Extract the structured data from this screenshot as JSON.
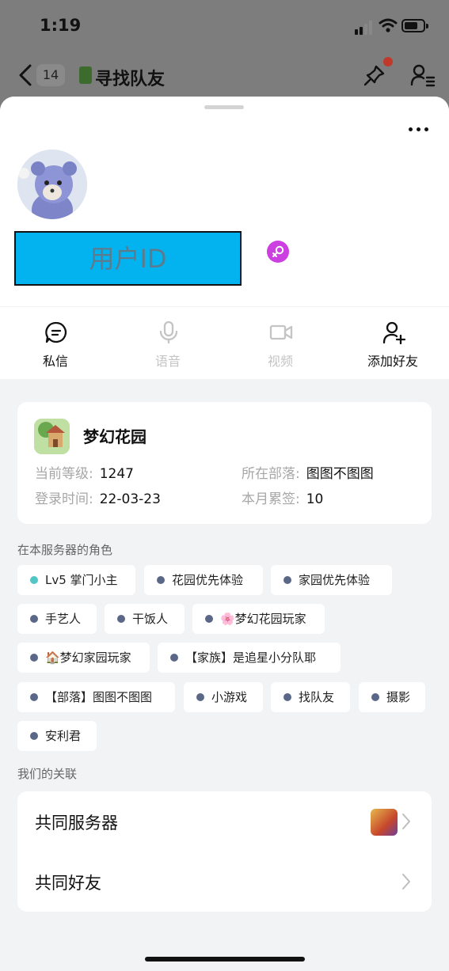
{
  "status_bar": {
    "time": "1:19"
  },
  "header": {
    "unread_count": "14",
    "title": "寻找队友",
    "icons": [
      "back-icon",
      "pin-icon",
      "members-icon"
    ]
  },
  "profile": {
    "uid": "用户ID",
    "gender_icon": "female-icon"
  },
  "actions": [
    {
      "label": "私信",
      "icon": "message-icon",
      "enabled": true
    },
    {
      "label": "语音",
      "icon": "mic-icon",
      "enabled": false
    },
    {
      "label": "视频",
      "icon": "video-icon",
      "enabled": false
    },
    {
      "label": "添加好友",
      "icon": "add-friend-icon",
      "enabled": true
    }
  ],
  "game_card": {
    "name": "梦幻花园",
    "level_label": "当前等级:",
    "level_value": "1247",
    "tribe_label": "所在部落:",
    "tribe_value": "图图不图图",
    "login_label": "登录时间:",
    "login_value": "22-03-23",
    "checkin_label": "本月累签:",
    "checkin_value": "10"
  },
  "roles_title": "在本服务器的角色",
  "roles": [
    "Lv5 掌门小主",
    "花园优先体验",
    "家园优先体验",
    "手艺人",
    "干饭人",
    "🌸梦幻花园玩家",
    "🏠梦幻家园玩家",
    "【家族】是追星小分队耶",
    "【部落】图图不图图",
    "小游戏",
    "找队友",
    "摄影",
    "安利君"
  ],
  "relation_title": "我们的关联",
  "relations": [
    {
      "label": "共同服务器"
    },
    {
      "label": "共同好友"
    }
  ],
  "colors": {
    "uid_box": "#03b3ef",
    "gender_badge": "#cc3fe0",
    "role_dot": "#5a6787",
    "level_dot": "#52c5c5"
  }
}
